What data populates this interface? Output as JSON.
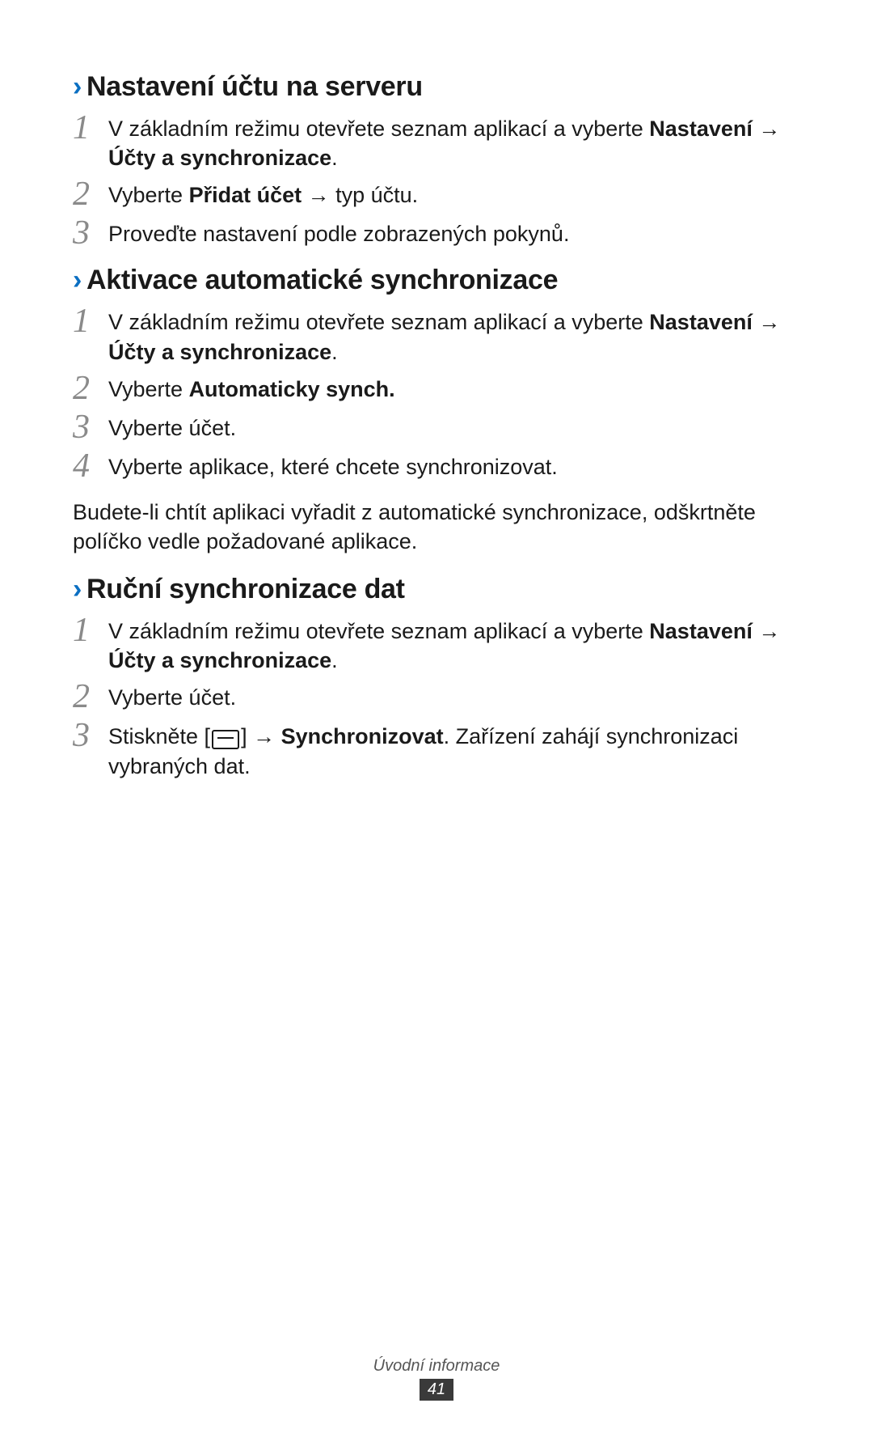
{
  "chevron": "›",
  "arrow": " → ",
  "sections": {
    "s1": {
      "title": "Nastavení účtu na serveru",
      "step1_a": "V základním režimu otevřete seznam aplikací a vyberte ",
      "step1_b": "Nastavení",
      "step1_c": "Účty a synchronizace",
      "step1_d": ".",
      "step2_a": "Vyberte ",
      "step2_b": "Přidat účet",
      "step2_c": " typ účtu.",
      "step3": "Proveďte nastavení podle zobrazených pokynů."
    },
    "s2": {
      "title": "Aktivace automatické synchronizace",
      "step1_a": "V základním režimu otevřete seznam aplikací a vyberte ",
      "step1_b": "Nastavení",
      "step1_c": "Účty a synchronizace",
      "step1_d": ".",
      "step2_a": "Vyberte ",
      "step2_b": "Automaticky synch.",
      "step3": "Vyberte účet.",
      "step4": "Vyberte aplikace, které chcete synchronizovat.",
      "note": "Budete-li chtít aplikaci vyřadit z automatické synchronizace, odškrtněte políčko vedle požadované aplikace."
    },
    "s3": {
      "title": "Ruční synchronizace dat",
      "step1_a": "V základním režimu otevřete seznam aplikací a vyberte ",
      "step1_b": "Nastavení",
      "step1_c": "Účty a synchronizace",
      "step1_d": ".",
      "step2": "Vyberte účet.",
      "step3_a": "Stiskněte [",
      "step3_b": "]",
      "step3_c": "Synchronizovat",
      "step3_d": ". Zařízení zahájí synchronizaci vybraných dat."
    }
  },
  "footer": {
    "label": "Úvodní informace",
    "page": "41"
  }
}
